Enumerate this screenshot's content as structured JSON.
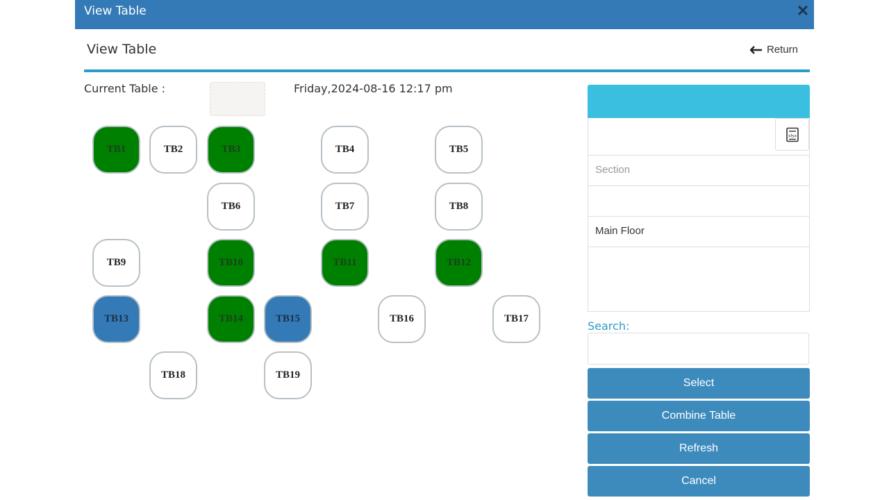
{
  "dialog": {
    "title": "View Table",
    "close_icon": "close-icon",
    "close_glyph": "✕"
  },
  "subheader": {
    "heading": "View Table",
    "return_label": "Return",
    "return_icon": "arrow-left-icon"
  },
  "current_table": {
    "label": "Current Table :",
    "value": ""
  },
  "datetime": "Friday,2024-08-16 12:17 pm",
  "colors": {
    "occupied": "#008000",
    "selected": "#337ab7",
    "available": "#ffffff",
    "header": "#337ab7",
    "panel_head": "#3bbfe0",
    "button": "#3d8bbd"
  },
  "tables": [
    {
      "label": "TB1",
      "status": "occupied"
    },
    {
      "label": "TB2",
      "status": "available"
    },
    {
      "label": "TB3",
      "status": "occupied"
    },
    {
      "label": "TB4",
      "status": "available"
    },
    {
      "label": "TB5",
      "status": "available"
    },
    {
      "label": "TB6",
      "status": "available"
    },
    {
      "label": "TB7",
      "status": "available"
    },
    {
      "label": "TB8",
      "status": "available"
    },
    {
      "label": "TB9",
      "status": "available"
    },
    {
      "label": "TB10",
      "status": "occupied"
    },
    {
      "label": "TB11",
      "status": "occupied"
    },
    {
      "label": "TB12",
      "status": "occupied"
    },
    {
      "label": "TB13",
      "status": "selected"
    },
    {
      "label": "TB14",
      "status": "occupied"
    },
    {
      "label": "TB15",
      "status": "selected"
    },
    {
      "label": "TB16",
      "status": "available"
    },
    {
      "label": "TB17",
      "status": "available"
    },
    {
      "label": "TB18",
      "status": "available"
    },
    {
      "label": "TB19",
      "status": "available"
    }
  ],
  "side_panel": {
    "export_icon": "xlsx-export-icon",
    "section_placeholder": "Section",
    "sections": [
      "",
      "Main Floor"
    ]
  },
  "search": {
    "label": "Search:",
    "value": ""
  },
  "buttons": {
    "select": "Select",
    "combine": "Combine Table",
    "refresh": "Refresh",
    "cancel": "Cancel"
  }
}
